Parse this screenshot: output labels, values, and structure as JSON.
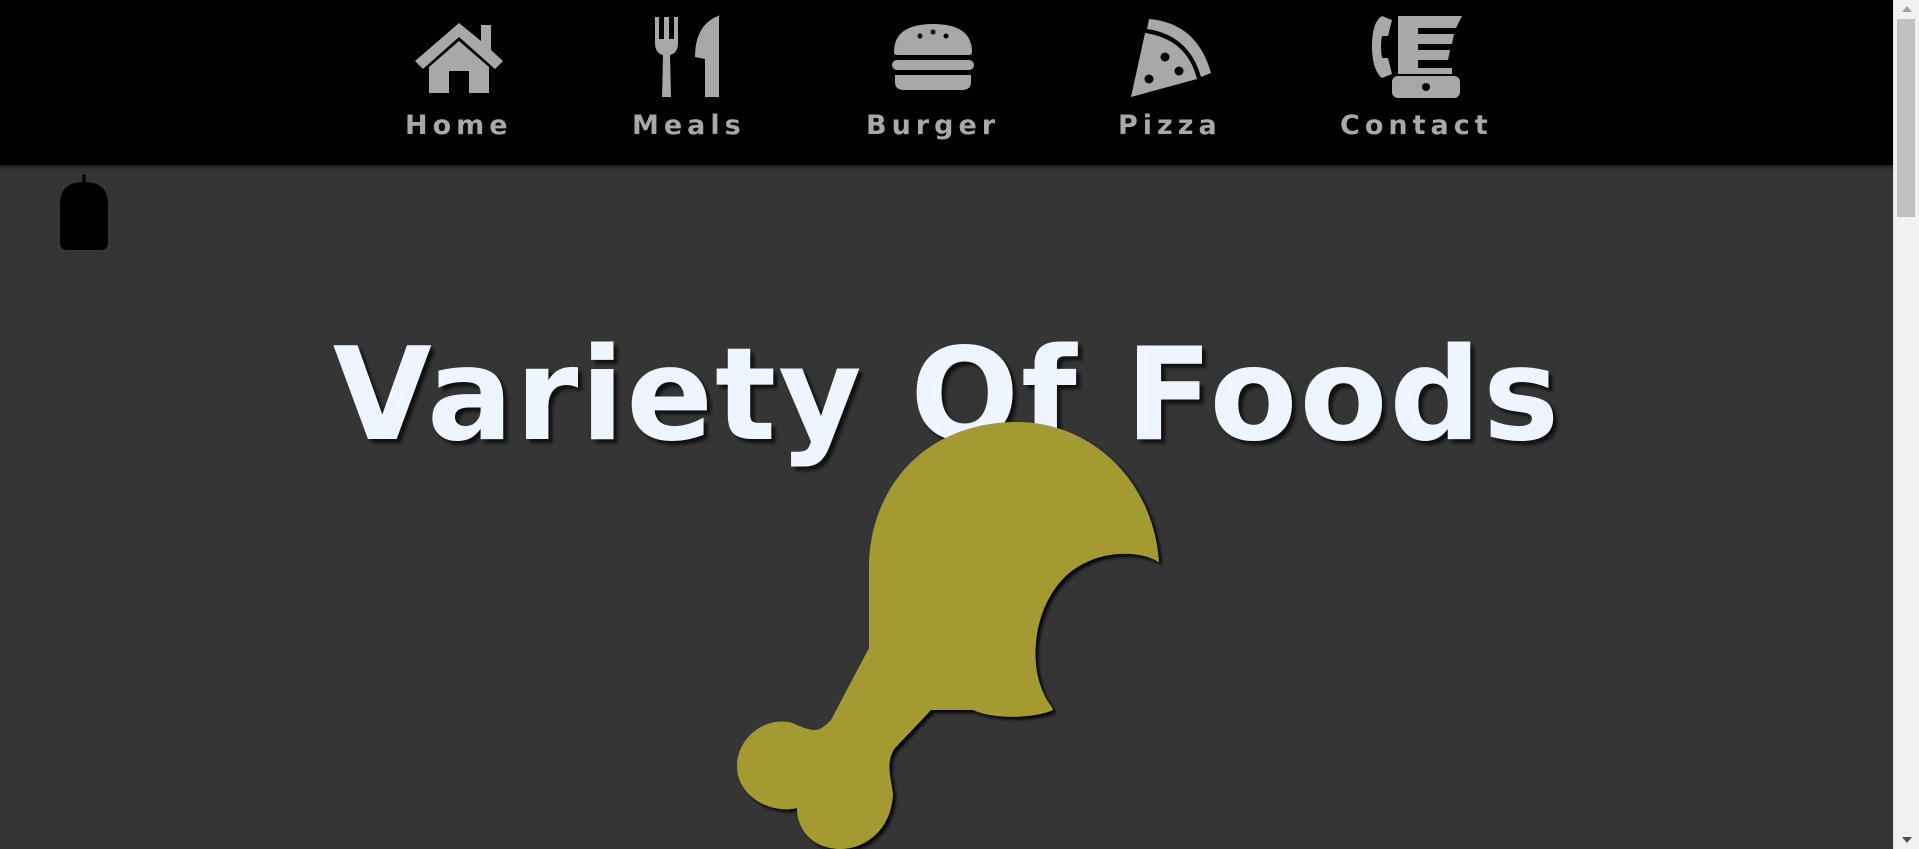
{
  "nav": {
    "items": [
      {
        "label": "Home",
        "icon": "house-icon"
      },
      {
        "label": "Meals",
        "icon": "fork-knife-icon"
      },
      {
        "label": "Burger",
        "icon": "burger-icon"
      },
      {
        "label": "Pizza",
        "icon": "pizza-slice-icon"
      },
      {
        "label": "Contact",
        "icon": "phone-fax-icon"
      }
    ]
  },
  "hero": {
    "title": "Variety Of Foods",
    "graphic": "chicken-leg-icon"
  },
  "colors": {
    "nav_background": "#000000",
    "page_background": "#353535",
    "nav_text": "#a8a8a8",
    "title_text": "#eef5ff",
    "graphic_fill": "#a39a30"
  }
}
